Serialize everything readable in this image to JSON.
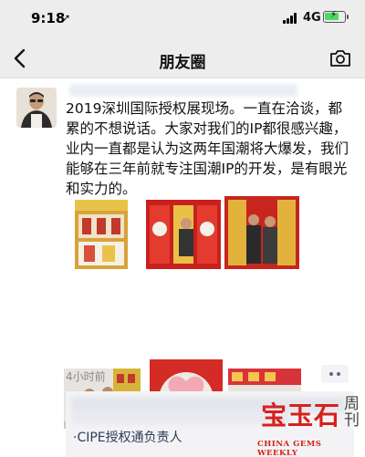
{
  "status_bar": {
    "time": "9:18",
    "location_glyph": "➚",
    "network": "4G",
    "battery_bolt": "⚡"
  },
  "nav": {
    "title": "朋友圈",
    "back_icon": "chevron-left-icon",
    "camera_icon": "camera-icon"
  },
  "post": {
    "text": "2019深圳国际授权展现场。一直在洽谈，都累的不想说话。大家对我们的IP都很感兴趣，业内一直都是认为这两年国潮将大爆发，我们能够在三年前就专注国潮IP的开发，是有眼光和实力的。",
    "photos": [
      "photo-booth-display",
      "photo-booth-posters",
      "photo-two-visitors",
      "photo-meeting",
      "photo-heart-figurine",
      "photo-booth-crowd"
    ],
    "time_ago": "4小时前",
    "more_icon": "more-dots-icon",
    "comment_tail": "·CIPE授权通负责人"
  },
  "watermark": {
    "main": "宝玉石",
    "side": "周刊",
    "sub": "CHINA GEMS WEEKLY"
  },
  "colors": {
    "nav_bg": "#ededed",
    "link": "#566b94",
    "battery": "#4cd964",
    "watermark_red": "#d7201c"
  }
}
